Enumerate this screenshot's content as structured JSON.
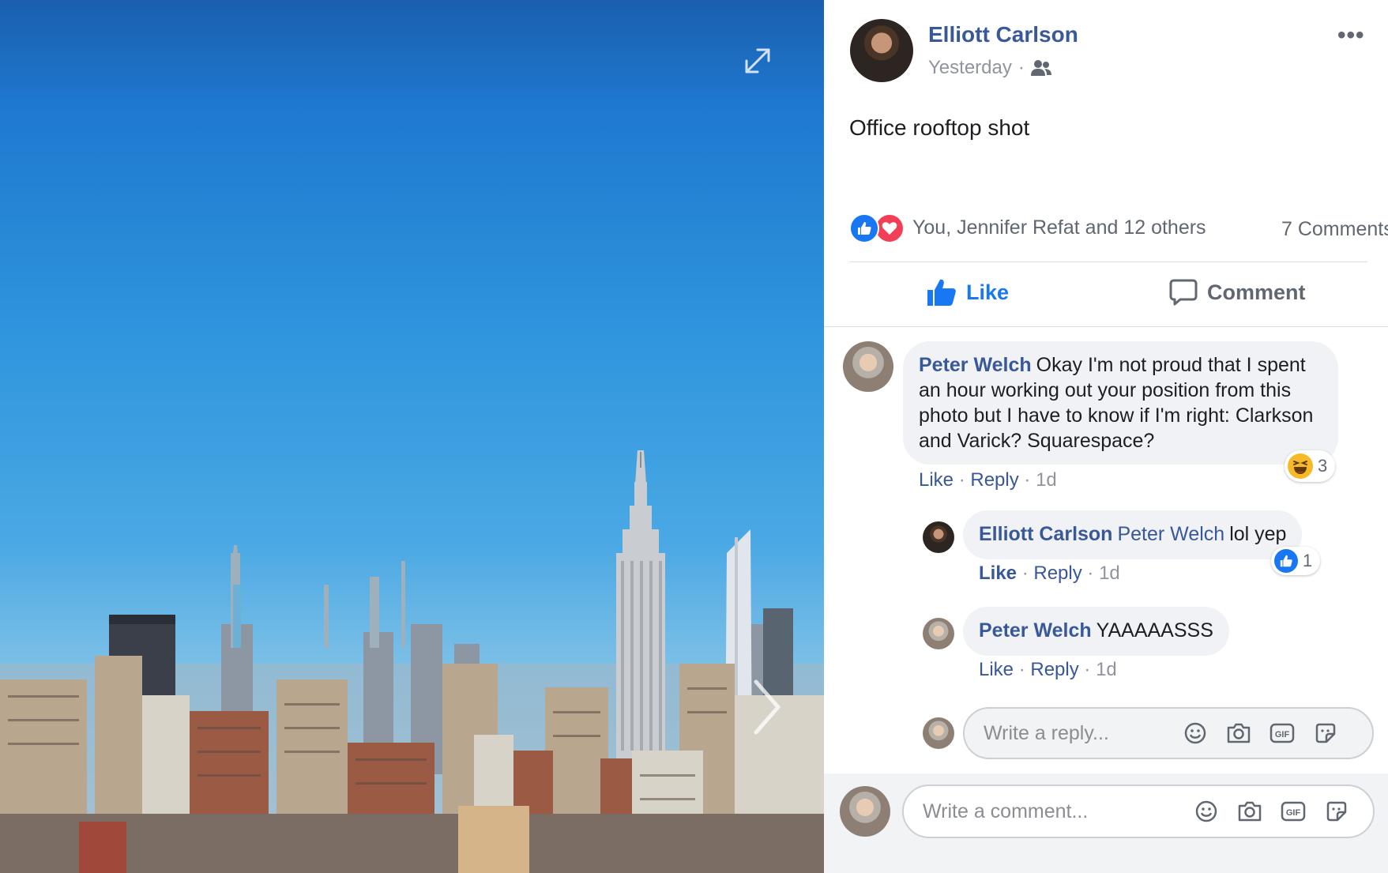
{
  "post": {
    "author": "Elliott Carlson",
    "time": "Yesterday",
    "time_separator": "·",
    "text": "Office rooftop shot",
    "reactions_summary": "You, Jennifer Refat and 12 others",
    "comments_count": "7 Comments",
    "actions": {
      "like": "Like",
      "comment": "Comment"
    },
    "more": "•••"
  },
  "comments": [
    {
      "author": "Peter Welch",
      "text": "Okay I'm not proud that I spent an hour working out your position from this photo but I have to know if I'm right: Clarkson and Varick? Squarespace?",
      "reaction_count": "3",
      "reaction_type": "haha",
      "meta": {
        "like": "Like",
        "reply": "Reply",
        "time": "1d",
        "sep": "·"
      }
    },
    {
      "author": "Elliott Carlson",
      "tag": "Peter Welch",
      "text": "lol yep",
      "reaction_count": "1",
      "reaction_type": "like",
      "meta": {
        "like": "Like",
        "reply": "Reply",
        "time": "1d",
        "sep": "·"
      }
    },
    {
      "author": "Peter Welch",
      "text": "YAAAAASSS",
      "meta": {
        "like": "Like",
        "reply": "Reply",
        "time": "1d",
        "sep": "·"
      }
    }
  ],
  "reply_box": {
    "placeholder": "Write a reply..."
  },
  "comment_box": {
    "placeholder": "Write a comment..."
  },
  "icons": [
    "expand-icon",
    "next-arrow-icon",
    "audience-friends-icon",
    "more-icon",
    "like-reaction-icon",
    "love-reaction-icon",
    "thumbs-up-icon",
    "comment-bubble-icon",
    "haha-reaction-icon",
    "emoji-icon",
    "camera-icon",
    "gif-icon",
    "sticker-icon"
  ],
  "colors": {
    "brand": "#385898",
    "accent": "#1877f2",
    "love": "#f33e58",
    "haha": "#f7b928"
  }
}
